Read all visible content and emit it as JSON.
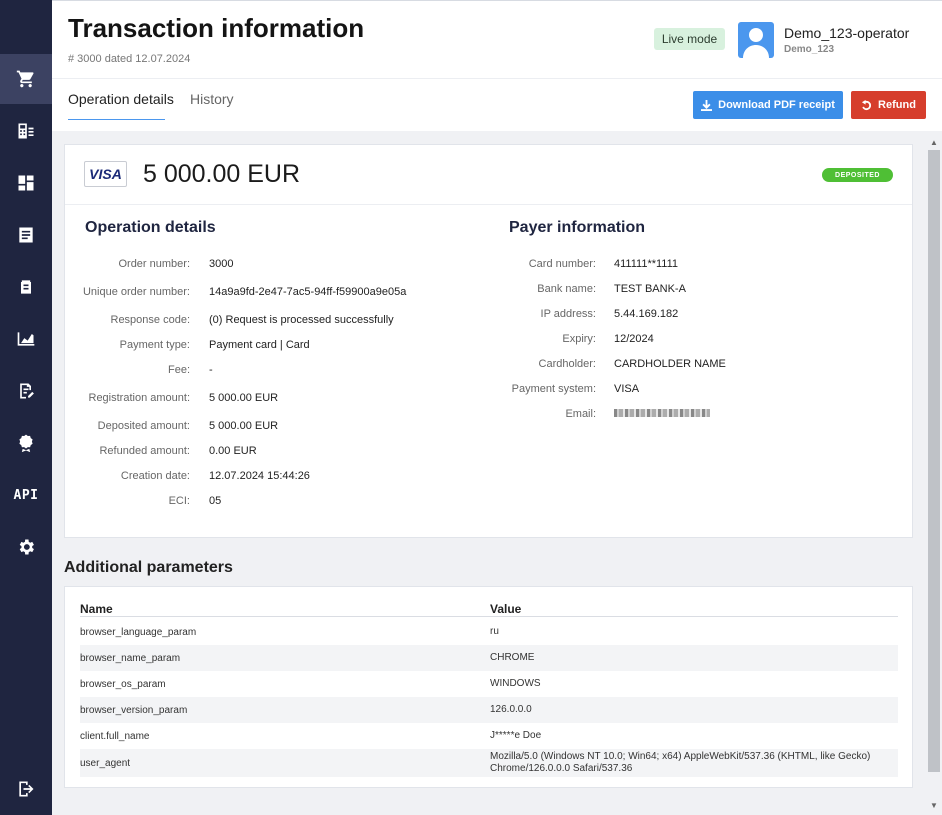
{
  "header": {
    "title": "Transaction information",
    "subtitle": "# 3000 dated 12.07.2024",
    "live_mode": "Live mode",
    "user_name": "Demo_123-operator",
    "user_sub": "Demo_123"
  },
  "tabs": {
    "operation_details": "Operation details",
    "history": "History"
  },
  "buttons": {
    "download_pdf": "Download PDF receipt",
    "refund": "Refund"
  },
  "summary": {
    "card_brand": "VISA",
    "amount": "5 000.00 EUR",
    "status": "DEPOSITED"
  },
  "operation": {
    "title": "Operation details",
    "rows": [
      {
        "label": "Order number:",
        "value": "3000"
      },
      {
        "label": "Unique order number:",
        "value": "14a9a9fd-2e47-7ac5-94ff-f59900a9e05a"
      },
      {
        "label": "Response code:",
        "value": "(0) Request is processed successfully"
      },
      {
        "label": "Payment type:",
        "value": "Payment card | Card"
      },
      {
        "label": "Fee:",
        "value": "-"
      },
      {
        "label": "Registration amount:",
        "value": "5 000.00 EUR"
      },
      {
        "label": "Deposited amount:",
        "value": "5 000.00 EUR"
      },
      {
        "label": "Refunded amount:",
        "value": "0.00 EUR"
      },
      {
        "label": "Creation date:",
        "value": "12.07.2024 15:44:26"
      },
      {
        "label": "ECI:",
        "value": "05"
      }
    ]
  },
  "payer": {
    "title": "Payer information",
    "rows": [
      {
        "label": "Card number:",
        "value": "411111**1111"
      },
      {
        "label": "Bank name:",
        "value": "TEST BANK-A"
      },
      {
        "label": "IP address:",
        "value": "5.44.169.182"
      },
      {
        "label": "Expiry:",
        "value": "12/2024"
      },
      {
        "label": "Cardholder:",
        "value": "CARDHOLDER NAME"
      },
      {
        "label": "Payment system:",
        "value": "VISA"
      },
      {
        "label": "Email:",
        "value": ""
      }
    ]
  },
  "additional": {
    "title": "Additional parameters",
    "col_name": "Name",
    "col_value": "Value",
    "rows": [
      {
        "name": "browser_language_param",
        "value": "ru"
      },
      {
        "name": "browser_name_param",
        "value": "CHROME"
      },
      {
        "name": "browser_os_param",
        "value": "WINDOWS"
      },
      {
        "name": "browser_version_param",
        "value": "126.0.0.0"
      },
      {
        "name": "client.full_name",
        "value": "J*****e Doe"
      },
      {
        "name": "user_agent",
        "value": "Mozilla/5.0 (Windows NT 10.0; Win64; x64) AppleWebKit/537.36 (KHTML, like Gecko) Chrome/126.0.0.0 Safari/537.36"
      }
    ]
  },
  "sidebar": {
    "api_label": "API"
  },
  "colors": {
    "sidebar_bg": "#1f2540",
    "primary": "#3b8ee8",
    "danger": "#d63e2c",
    "success": "#4fbf35"
  }
}
